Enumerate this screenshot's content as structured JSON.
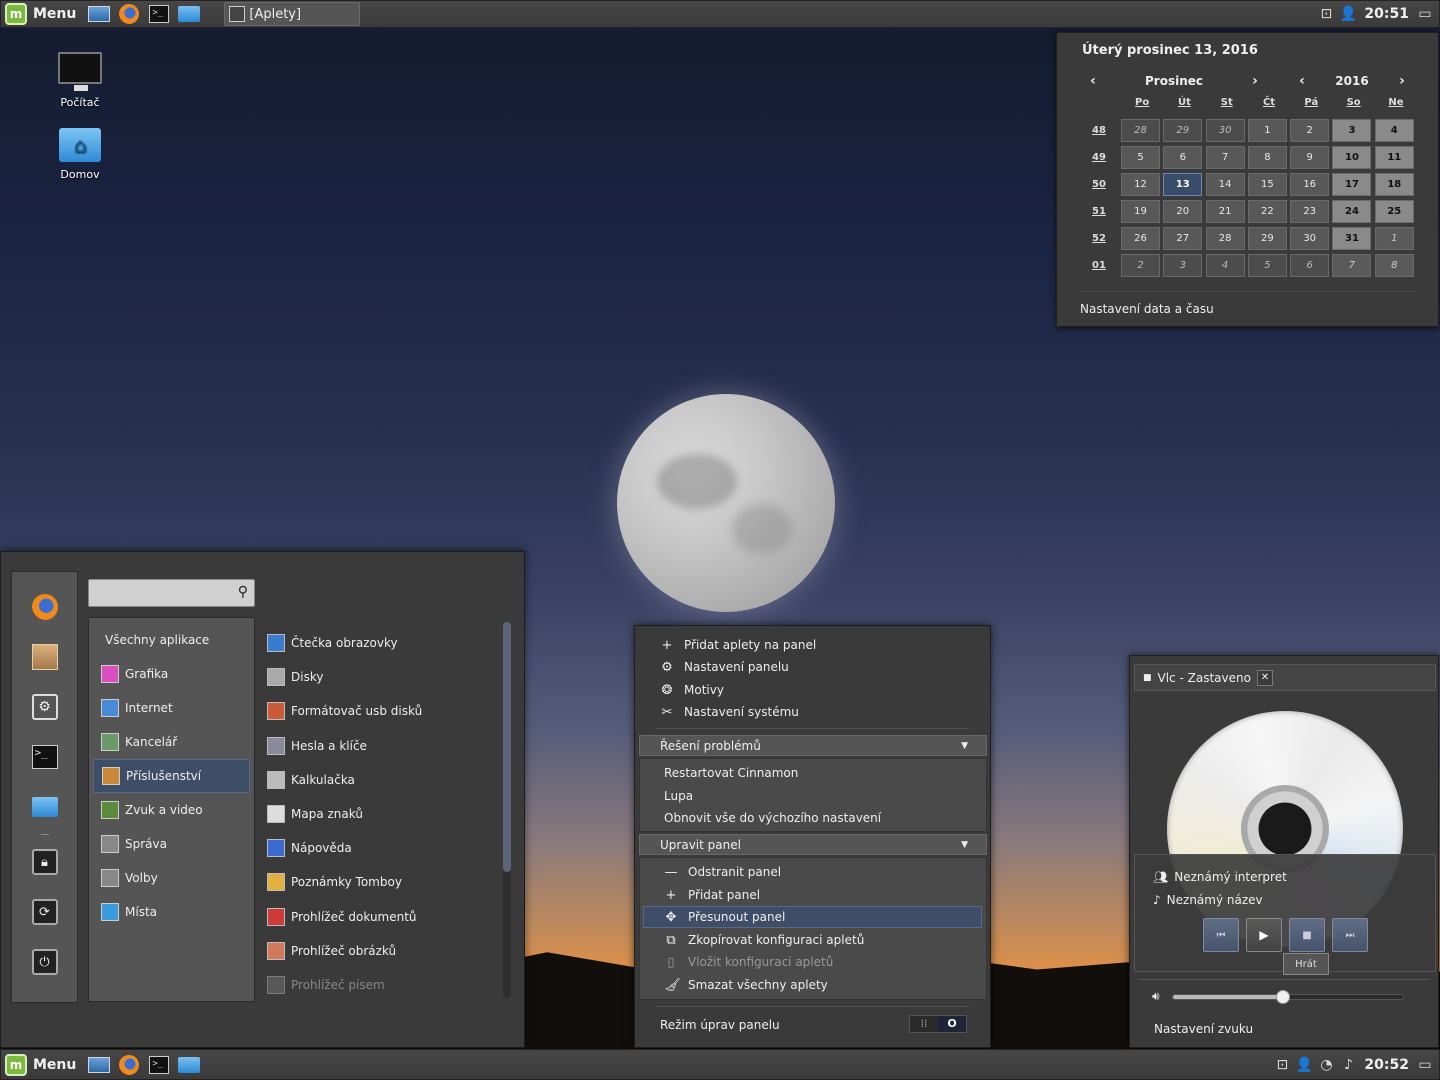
{
  "top_panel": {
    "menu_label": "Menu",
    "window_title": "[Aplety]",
    "clock": "20:51",
    "icons": [
      "mint-logo-icon",
      "show-desktop-icon",
      "firefox-icon",
      "terminal-icon",
      "folder-icon",
      "system-monitor-icon",
      "user-icon",
      "workspace-icon"
    ]
  },
  "bottom_panel": {
    "menu_label": "Menu",
    "clock": "20:52",
    "icons": [
      "mint-logo-icon",
      "show-desktop-icon",
      "firefox-icon",
      "terminal-icon",
      "folder-icon",
      "system-monitor-icon",
      "user-icon",
      "wifi-icon",
      "music-icon",
      "workspace-icon"
    ]
  },
  "desktop": {
    "icons": [
      {
        "label": "Počítač",
        "icon": "computer-icon"
      },
      {
        "label": "Domov",
        "icon": "home-folder-icon"
      }
    ]
  },
  "calendar": {
    "date_title": "Úterý prosinec 13, 2016",
    "month": "Prosinec",
    "year": "2016",
    "day_headers": [
      "Po",
      "Út",
      "St",
      "Čt",
      "Pá",
      "So",
      "Ne"
    ],
    "week_numbers": [
      "48",
      "49",
      "50",
      "51",
      "52",
      "01"
    ],
    "weeks": [
      [
        "28",
        "29",
        "30",
        "1",
        "2",
        "3",
        "4"
      ],
      [
        "5",
        "6",
        "7",
        "8",
        "9",
        "10",
        "11"
      ],
      [
        "12",
        "13",
        "14",
        "15",
        "16",
        "17",
        "18"
      ],
      [
        "19",
        "20",
        "21",
        "22",
        "23",
        "24",
        "25"
      ],
      [
        "26",
        "27",
        "28",
        "29",
        "30",
        "31",
        "1"
      ],
      [
        "2",
        "3",
        "4",
        "5",
        "6",
        "7",
        "8"
      ]
    ],
    "today": "13",
    "settings_label": "Nastavení data a času"
  },
  "app_menu": {
    "search_placeholder": "",
    "favorites": [
      "firefox-icon",
      "package-icon",
      "settings-icon",
      "terminal-icon",
      "folder-icon",
      "lock-icon",
      "logout-icon",
      "power-icon"
    ],
    "categories": [
      {
        "label": "Všechny aplikace",
        "icon": ""
      },
      {
        "label": "Grafika",
        "icon": "graphics-icon",
        "color": "#d94fbf"
      },
      {
        "label": "Internet",
        "icon": "internet-icon",
        "color": "#4a8ad6"
      },
      {
        "label": "Kancelář",
        "icon": "office-icon",
        "color": "#6a9a6a"
      },
      {
        "label": "Příslušenství",
        "icon": "accessories-icon",
        "color": "#c98a3a"
      },
      {
        "label": "Zvuk a video",
        "icon": "multimedia-icon",
        "color": "#5a8a3a"
      },
      {
        "label": "Správa",
        "icon": "administration-icon",
        "color": "#888888"
      },
      {
        "label": "Volby",
        "icon": "preferences-icon",
        "color": "#888888"
      },
      {
        "label": "Místa",
        "icon": "places-icon",
        "color": "#3a9ae0"
      }
    ],
    "selected_category": "Příslušenství",
    "apps": [
      {
        "label": "Čtečka obrazovky",
        "icon": "screen-reader-icon",
        "color": "#3a7ad0"
      },
      {
        "label": "Disky",
        "icon": "disks-icon",
        "color": "#aaaaaa"
      },
      {
        "label": "Formátovač usb disků",
        "icon": "usb-formatter-icon",
        "color": "#cc5a3a"
      },
      {
        "label": "Hesla a klíče",
        "icon": "passwords-icon",
        "color": "#8a8a9a"
      },
      {
        "label": "Kalkulačka",
        "icon": "calculator-icon",
        "color": "#bbbbbb"
      },
      {
        "label": "Mapa znaků",
        "icon": "character-map-icon",
        "color": "#dddddd"
      },
      {
        "label": "Nápověda",
        "icon": "help-icon",
        "color": "#3a6ad0"
      },
      {
        "label": "Poznámky Tomboy",
        "icon": "tomboy-icon",
        "color": "#e0b040"
      },
      {
        "label": "Prohlížeč dokumentů",
        "icon": "document-viewer-icon",
        "color": "#cc3a3a"
      },
      {
        "label": "Prohlížeč obrázků",
        "icon": "image-viewer-icon",
        "color": "#d07a5a"
      },
      {
        "label": "Prohlížeč písem",
        "icon": "font-viewer-icon",
        "color": "#777777"
      }
    ]
  },
  "context_menu": {
    "items": [
      {
        "label": "Přidat aplety na panel",
        "icon": "plus-icon"
      },
      {
        "label": "Nastavení panelu",
        "icon": "gear-icon"
      },
      {
        "label": "Motivy",
        "icon": "themes-icon"
      },
      {
        "label": "Nastavení systému",
        "icon": "tools-icon"
      }
    ],
    "troubleshoot": {
      "label": "Řešení problémů",
      "items": [
        "Restartovat Cinnamon",
        "Lupa",
        "Obnovit vše do výchozího nastavení"
      ]
    },
    "edit_panel": {
      "label": "Upravit panel",
      "items": [
        {
          "label": "Odstranit panel",
          "icon": "minus-icon"
        },
        {
          "label": "Přidat panel",
          "icon": "plus-icon"
        },
        {
          "label": "Přesunout panel",
          "icon": "move-icon"
        },
        {
          "label": "Zkopírovat konfiguraci apletů",
          "icon": "copy-icon"
        },
        {
          "label": "Vložit konfiguraci apletů",
          "icon": "paste-icon"
        },
        {
          "label": "Smazat všechny aplety",
          "icon": "clear-icon"
        }
      ],
      "highlighted": "Přesunout panel"
    },
    "edit_mode_label": "Režim úprav panelu",
    "edit_mode_state": "off"
  },
  "vlc": {
    "title": "Vlc - Zastaveno",
    "artist": "Neznámý interpret",
    "track": "Neznámý název",
    "tooltip": "Hrát",
    "volume_fraction": 0.48,
    "settings_label": "Nastavení zvuku"
  }
}
